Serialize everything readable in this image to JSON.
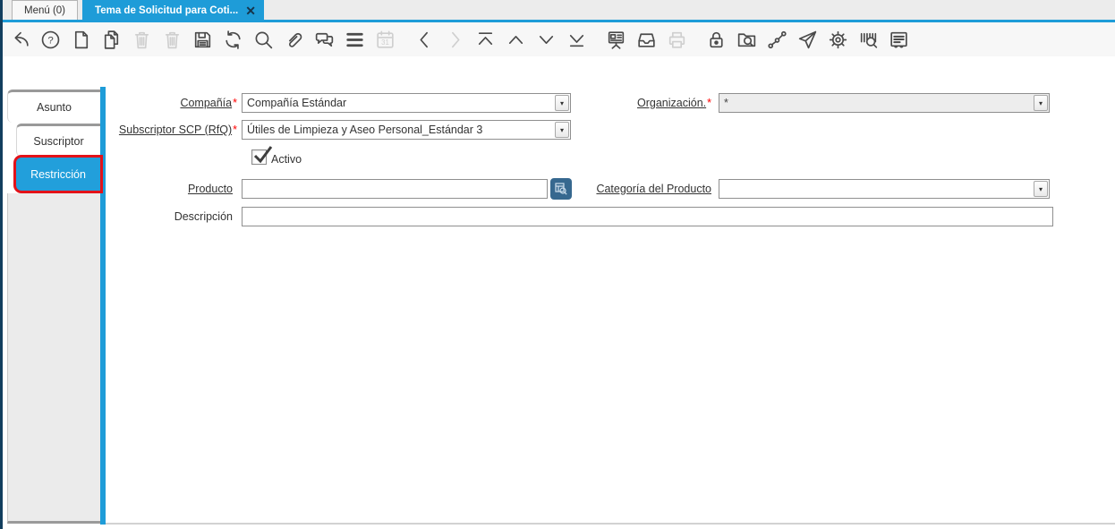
{
  "tab_bar": {
    "tabs": [
      {
        "label": "Menú (0)",
        "active": false,
        "closable": false
      },
      {
        "label": "Tema de Solicitud para Coti...",
        "active": true,
        "closable": true,
        "close_glyph": "✕"
      }
    ]
  },
  "toolbar": {
    "buttons": [
      {
        "name": "undo",
        "enabled": true
      },
      {
        "name": "help",
        "enabled": true
      },
      {
        "name": "new-record",
        "enabled": true
      },
      {
        "name": "copy-record",
        "enabled": true
      },
      {
        "name": "delete-record",
        "enabled": false
      },
      {
        "name": "delete-selection",
        "enabled": false
      },
      {
        "name": "save",
        "enabled": true
      },
      {
        "name": "refresh",
        "enabled": true
      },
      {
        "name": "find",
        "enabled": true
      },
      {
        "name": "attachment",
        "enabled": true
      },
      {
        "name": "chat",
        "enabled": true
      },
      {
        "name": "grid-toggle",
        "enabled": true
      },
      {
        "name": "calendar",
        "enabled": false
      },
      {
        "name": "previous",
        "enabled": true,
        "group_start": true
      },
      {
        "name": "next",
        "enabled": false
      },
      {
        "name": "first-record",
        "enabled": true
      },
      {
        "name": "up-record",
        "enabled": true
      },
      {
        "name": "down-record",
        "enabled": true
      },
      {
        "name": "last-record",
        "enabled": true
      },
      {
        "name": "report",
        "enabled": true,
        "group_start": true
      },
      {
        "name": "archive",
        "enabled": true
      },
      {
        "name": "print",
        "enabled": false
      },
      {
        "name": "lock",
        "enabled": true,
        "group_start": true
      },
      {
        "name": "zoom-across",
        "enabled": true
      },
      {
        "name": "workflow",
        "enabled": true
      },
      {
        "name": "send",
        "enabled": true
      },
      {
        "name": "preferences",
        "enabled": true
      },
      {
        "name": "product-info",
        "enabled": true
      },
      {
        "name": "note",
        "enabled": true
      }
    ]
  },
  "sidebar": {
    "tabs": [
      {
        "label": "Asunto",
        "selected": false,
        "highlighted": false,
        "level": 0
      },
      {
        "label": "Suscriptor",
        "selected": false,
        "highlighted": false,
        "level": 1
      },
      {
        "label": "Restricción",
        "selected": true,
        "highlighted": true,
        "level": 1
      }
    ]
  },
  "form": {
    "compania": {
      "label": "Compañía",
      "req": "*",
      "value": "Compañía Estándar"
    },
    "organizacion": {
      "label": "Organización.",
      "req": "*",
      "value": "*"
    },
    "subscriptor": {
      "label": "Subscriptor SCP (RfQ)",
      "req": "*",
      "value": "Útiles de Limpieza y Aseo Personal_Estándar 3"
    },
    "activo": {
      "label": "Activo",
      "checked": true
    },
    "producto": {
      "label": "Producto",
      "value": ""
    },
    "categoria": {
      "label": "Categoría del Producto",
      "value": ""
    },
    "descripcion": {
      "label": "Descripción",
      "value": ""
    }
  },
  "glyphs": {
    "combo_arrow": "▾"
  },
  "colors": {
    "accent_blue": "#1e9cd8",
    "highlight_red": "#e31219",
    "navy_edge": "#123e5e",
    "record_button_blue": "#36688f",
    "toolbar_bg": "#f7f7f7"
  }
}
